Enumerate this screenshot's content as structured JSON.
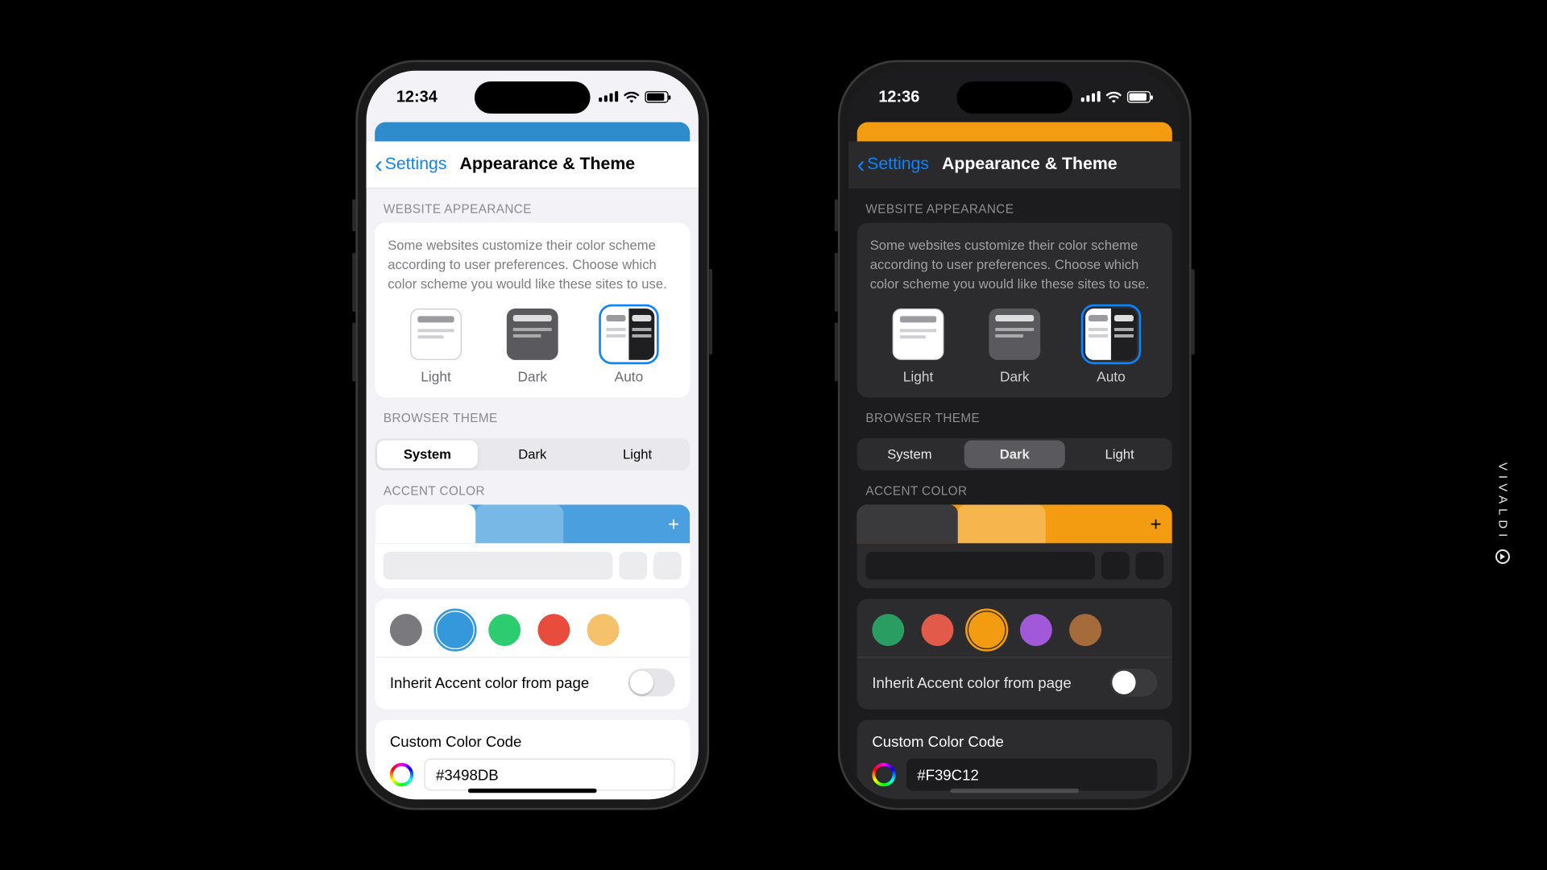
{
  "brand": "VIVALDI",
  "phones": {
    "light": {
      "time": "12:34",
      "accent_strip": "#2e8bcc",
      "nav": {
        "back": "Settings",
        "title": "Appearance & Theme"
      },
      "website_appearance": {
        "header": "WEBSITE APPEARANCE",
        "desc": "Some websites customize their color scheme according to user preferences. Choose which color scheme you would like these sites to use.",
        "options": [
          "Light",
          "Dark",
          "Auto"
        ],
        "selected": "Auto"
      },
      "browser_theme": {
        "header": "BROWSER THEME",
        "options": [
          "System",
          "Dark",
          "Light"
        ],
        "selected": "System"
      },
      "accent": {
        "header": "ACCENT COLOR",
        "tab_bg": "#4aa0de",
        "tab_active_bg": "#ffffff",
        "plus": "+",
        "preview_addr_bg": "#ececef",
        "preview_sq_bg": "#ececef",
        "swatches": [
          "#7a7a7e",
          "#3498db",
          "#2ecc71",
          "#e74c3c",
          "#f5c26b"
        ],
        "selected_swatch": 1,
        "ring_color": "#3498db",
        "inherit_label": "Inherit Accent color from page",
        "inherit_on": false
      },
      "custom": {
        "title": "Custom Color Code",
        "value": "#3498DB"
      }
    },
    "dark": {
      "time": "12:36",
      "accent_strip": "#f39c12",
      "nav": {
        "back": "Settings",
        "title": "Appearance & Theme"
      },
      "website_appearance": {
        "header": "WEBSITE APPEARANCE",
        "desc": "Some websites customize their color scheme according to user preferences. Choose which color scheme you would like these sites to use.",
        "options": [
          "Light",
          "Dark",
          "Auto"
        ],
        "selected": "Auto"
      },
      "browser_theme": {
        "header": "BROWSER THEME",
        "options": [
          "System",
          "Dark",
          "Light"
        ],
        "selected": "Dark"
      },
      "accent": {
        "header": "ACCENT COLOR",
        "tab_bg": "#f39c12",
        "tab_active_bg": "#3a3a3c",
        "plus": "+",
        "preview_addr_bg": "#1c1c1e",
        "preview_sq_bg": "#1c1c1e",
        "swatches": [
          "#2a9d62",
          "#e25b4a",
          "#f39c12",
          "#a259d9",
          "#a66b3a"
        ],
        "selected_swatch": 2,
        "ring_color": "#f39c12",
        "inherit_label": "Inherit Accent color from page",
        "inherit_on": false
      },
      "custom": {
        "title": "Custom Color Code",
        "value": "#F39C12"
      }
    }
  }
}
